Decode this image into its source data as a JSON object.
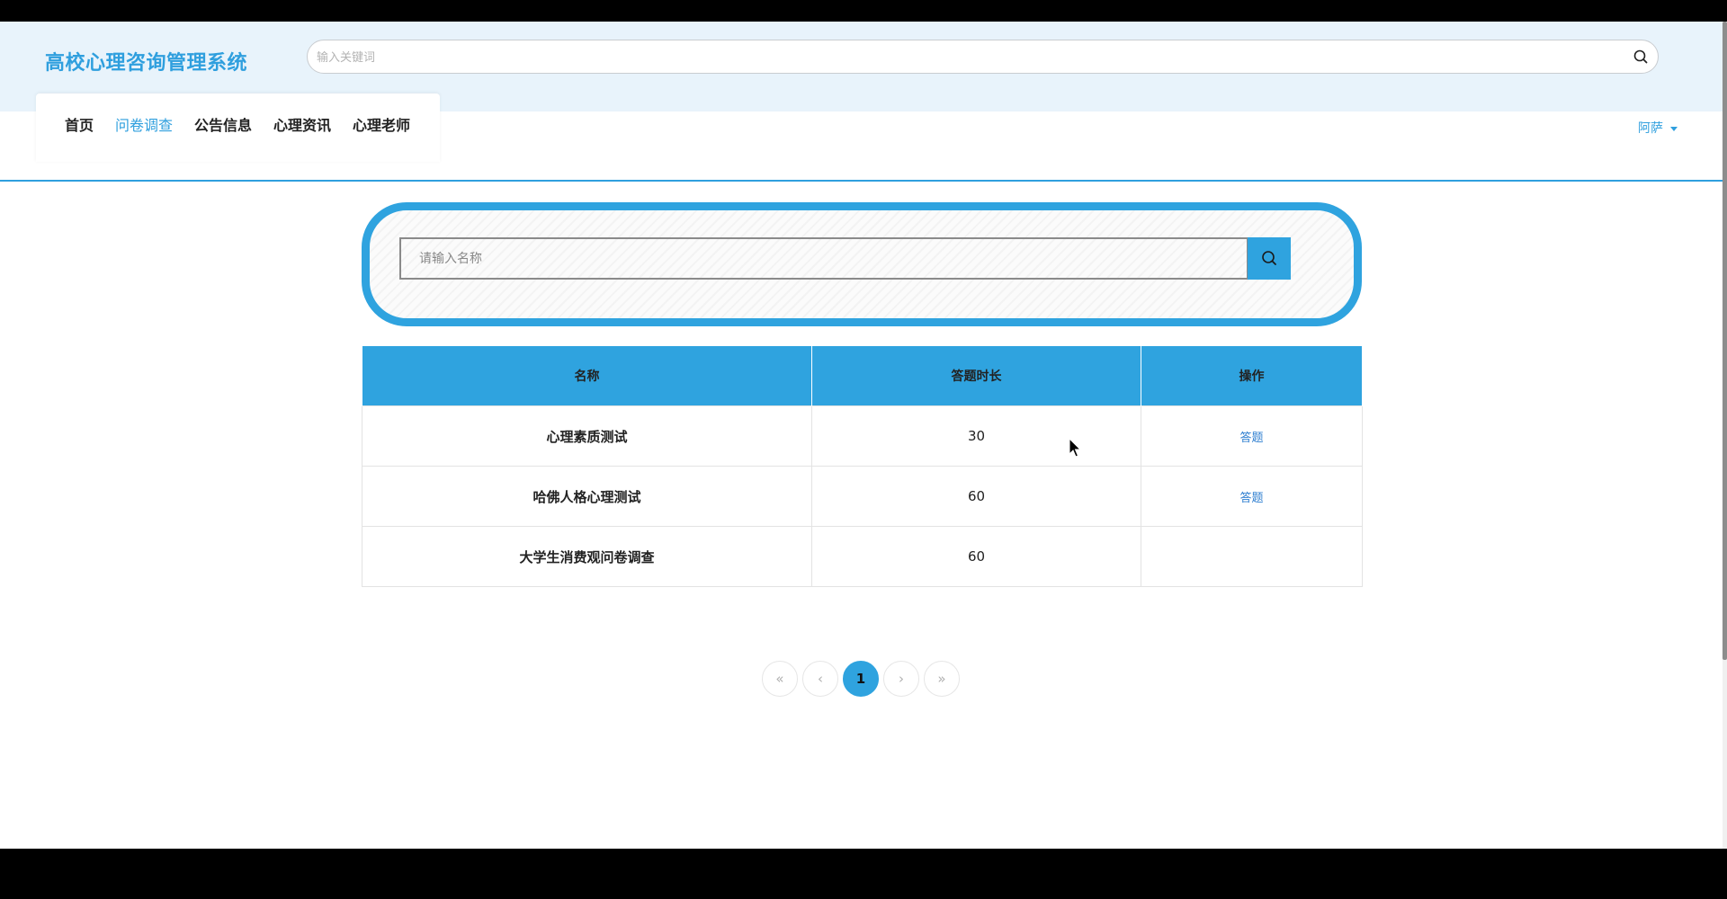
{
  "app": {
    "title": "高校心理咨询管理系统"
  },
  "global_search": {
    "placeholder": "输入关键词",
    "icon": "search-icon"
  },
  "nav": {
    "items": [
      {
        "label": "首页",
        "active": false
      },
      {
        "label": "问卷调查",
        "active": true
      },
      {
        "label": "公告信息",
        "active": false
      },
      {
        "label": "心理资讯",
        "active": false
      },
      {
        "label": "心理老师",
        "active": false
      }
    ]
  },
  "user": {
    "name": "阿萨",
    "icon": "caret-down-icon"
  },
  "name_search": {
    "placeholder": "请输入名称",
    "icon": "search-icon"
  },
  "table": {
    "headers": [
      "名称",
      "答题时长",
      "操作"
    ],
    "rows": [
      {
        "name": "心理素质测试",
        "duration": "30",
        "action": "答题"
      },
      {
        "name": "哈佛人格心理测试",
        "duration": "60",
        "action": "答题"
      },
      {
        "name": "大学生消费观问卷调查",
        "duration": "60",
        "action": ""
      }
    ]
  },
  "pagination": {
    "first": "«",
    "prev": "‹",
    "current": "1",
    "next": "›",
    "last": "»"
  },
  "colors": {
    "accent": "#2fa3df",
    "header_bg": "#e8f3fb",
    "link": "#2f7fd0"
  }
}
